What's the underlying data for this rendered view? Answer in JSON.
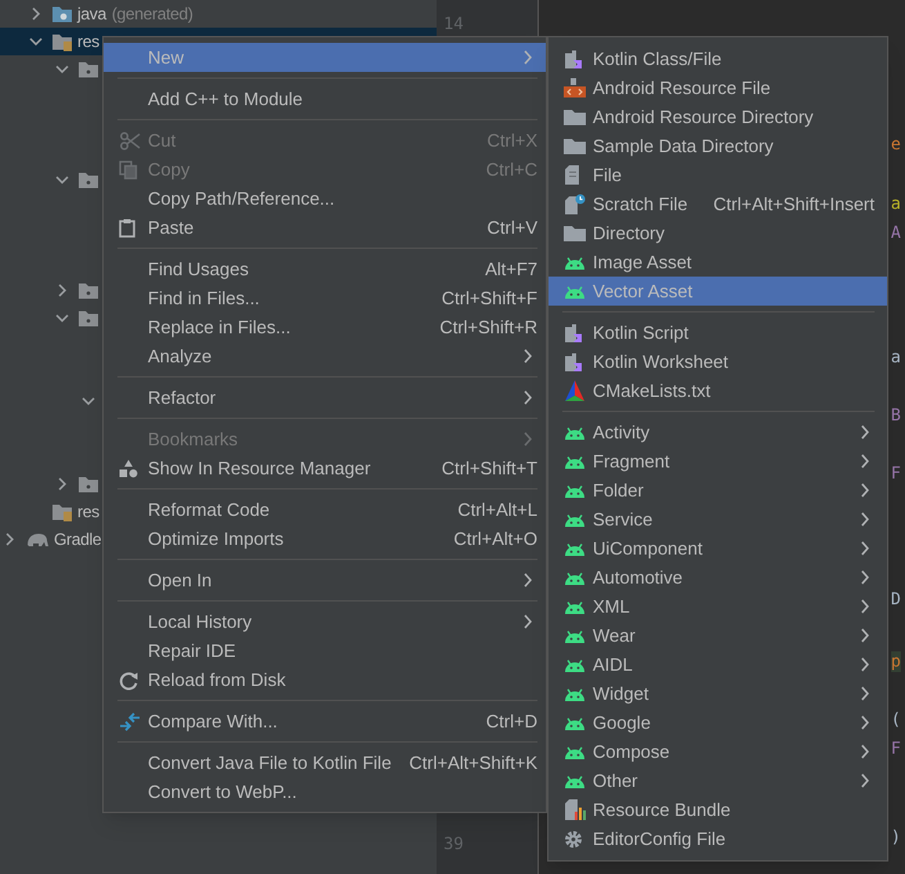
{
  "project_tree": [
    {
      "children": [
        {
          "label": "java",
          "note": "(generated)",
          "kind": "java",
          "expanded": false,
          "selected": false
        },
        {
          "label": "res",
          "kind": "res",
          "expanded": true,
          "selected": true,
          "children": [
            {
              "kind": "folder",
              "expanded": true,
              "selected": false
            },
            {
              "kind": "folder",
              "expanded": true,
              "selected": false
            },
            {
              "kind": "folder",
              "expanded": false,
              "selected": false
            },
            {
              "kind": "folder",
              "expanded": true,
              "selected": false,
              "children": [
                {
                  "expanded": true,
                  "selected": false
                }
              ]
            },
            {
              "kind": "folder",
              "expanded": false,
              "selected": false
            }
          ]
        },
        {
          "label": "res",
          "kind": "res",
          "selected": false
        }
      ]
    },
    {
      "label": "Gradle",
      "kind": "gradle",
      "expanded": false,
      "selected": false
    }
  ],
  "line_numbers": [
    "14",
    "39"
  ],
  "code_fragments": [
    {
      "text": "e",
      "color": "#cc7832"
    },
    {
      "text": "a",
      "color": "#bbb529"
    },
    {
      "text": "A",
      "color": "#9876aa"
    },
    {
      "text": "a",
      "color": "#a9b7c6"
    },
    {
      "text": "B",
      "color": "#9876aa"
    },
    {
      "text": "F",
      "color": "#9876aa"
    },
    {
      "text": "D",
      "color": "#a9b7c6"
    },
    {
      "text": "p",
      "color": "#cc7832"
    },
    {
      "text": "(",
      "color": "#a9b7c6"
    },
    {
      "text": "F",
      "color": "#9876aa"
    },
    {
      "text": ")",
      "color": "#a9b7c6"
    }
  ],
  "context_menu": {
    "items": [
      {
        "kind": "item",
        "label": "New",
        "has_submenu": true,
        "disabled": false,
        "selected": true
      },
      {
        "kind": "separator"
      },
      {
        "kind": "item",
        "label": "Add C++ to Module",
        "has_submenu": false,
        "disabled": false,
        "selected": false
      },
      {
        "kind": "separator"
      },
      {
        "kind": "item",
        "label": "Cut",
        "shortcut": "Ctrl+X",
        "has_submenu": false,
        "disabled": true,
        "selected": false
      },
      {
        "kind": "item",
        "label": "Copy",
        "shortcut": "Ctrl+C",
        "has_submenu": false,
        "disabled": true,
        "selected": false
      },
      {
        "kind": "item",
        "label": "Copy Path/Reference...",
        "has_submenu": false,
        "disabled": false,
        "selected": false
      },
      {
        "kind": "item",
        "label": "Paste",
        "shortcut": "Ctrl+V",
        "has_submenu": false,
        "disabled": false,
        "selected": false
      },
      {
        "kind": "separator"
      },
      {
        "kind": "item",
        "label": "Find Usages",
        "shortcut": "Alt+F7",
        "has_submenu": false,
        "disabled": false,
        "selected": false
      },
      {
        "kind": "item",
        "label": "Find in Files...",
        "shortcut": "Ctrl+Shift+F",
        "has_submenu": false,
        "disabled": false,
        "selected": false
      },
      {
        "kind": "item",
        "label": "Replace in Files...",
        "shortcut": "Ctrl+Shift+R",
        "has_submenu": false,
        "disabled": false,
        "selected": false
      },
      {
        "kind": "item",
        "label": "Analyze",
        "has_submenu": true,
        "disabled": false,
        "selected": false
      },
      {
        "kind": "separator"
      },
      {
        "kind": "item",
        "label": "Refactor",
        "has_submenu": true,
        "disabled": false,
        "selected": false
      },
      {
        "kind": "separator"
      },
      {
        "kind": "item",
        "label": "Bookmarks",
        "has_submenu": true,
        "disabled": true,
        "selected": false
      },
      {
        "kind": "item",
        "label": "Show In Resource Manager",
        "shortcut": "Ctrl+Shift+T",
        "has_submenu": false,
        "disabled": false,
        "selected": false
      },
      {
        "kind": "separator"
      },
      {
        "kind": "item",
        "label": "Reformat Code",
        "shortcut": "Ctrl+Alt+L",
        "has_submenu": false,
        "disabled": false,
        "selected": false
      },
      {
        "kind": "item",
        "label": "Optimize Imports",
        "shortcut": "Ctrl+Alt+O",
        "has_submenu": false,
        "disabled": false,
        "selected": false
      },
      {
        "kind": "separator"
      },
      {
        "kind": "item",
        "label": "Open In",
        "has_submenu": true,
        "disabled": false,
        "selected": false
      },
      {
        "kind": "separator"
      },
      {
        "kind": "item",
        "label": "Local History",
        "has_submenu": true,
        "disabled": false,
        "selected": false
      },
      {
        "kind": "item",
        "label": "Repair IDE",
        "has_submenu": false,
        "disabled": false,
        "selected": false
      },
      {
        "kind": "item",
        "label": "Reload from Disk",
        "has_submenu": false,
        "disabled": false,
        "selected": false
      },
      {
        "kind": "separator"
      },
      {
        "kind": "item",
        "label": "Compare With...",
        "shortcut": "Ctrl+D",
        "has_submenu": false,
        "disabled": false,
        "selected": false
      },
      {
        "kind": "separator"
      },
      {
        "kind": "item",
        "label": "Convert Java File to Kotlin File",
        "shortcut": "Ctrl+Alt+Shift+K",
        "has_submenu": false,
        "disabled": false,
        "selected": false
      },
      {
        "kind": "item",
        "label": "Convert to WebP...",
        "has_submenu": false,
        "disabled": false,
        "selected": false
      }
    ]
  },
  "new_submenu": {
    "items": [
      {
        "kind": "item",
        "label": "Kotlin Class/File",
        "has_submenu": false,
        "selected": false
      },
      {
        "kind": "item",
        "label": "Android Resource File",
        "has_submenu": false,
        "selected": false
      },
      {
        "kind": "item",
        "label": "Android Resource Directory",
        "has_submenu": false,
        "selected": false
      },
      {
        "kind": "item",
        "label": "Sample Data Directory",
        "has_submenu": false,
        "selected": false
      },
      {
        "kind": "item",
        "label": "File",
        "has_submenu": false,
        "selected": false
      },
      {
        "kind": "item",
        "label": "Scratch File",
        "shortcut": "Ctrl+Alt+Shift+Insert",
        "has_submenu": false,
        "selected": false
      },
      {
        "kind": "item",
        "label": "Directory",
        "has_submenu": false,
        "selected": false
      },
      {
        "kind": "item",
        "label": "Image Asset",
        "has_submenu": false,
        "selected": false
      },
      {
        "kind": "item",
        "label": "Vector Asset",
        "has_submenu": false,
        "selected": true
      },
      {
        "kind": "separator"
      },
      {
        "kind": "item",
        "label": "Kotlin Script",
        "has_submenu": false,
        "selected": false
      },
      {
        "kind": "item",
        "label": "Kotlin Worksheet",
        "has_submenu": false,
        "selected": false
      },
      {
        "kind": "item",
        "label": "CMakeLists.txt",
        "has_submenu": false,
        "selected": false
      },
      {
        "kind": "separator"
      },
      {
        "kind": "item",
        "label": "Activity",
        "has_submenu": true,
        "selected": false
      },
      {
        "kind": "item",
        "label": "Fragment",
        "has_submenu": true,
        "selected": false
      },
      {
        "kind": "item",
        "label": "Folder",
        "has_submenu": true,
        "selected": false
      },
      {
        "kind": "item",
        "label": "Service",
        "has_submenu": true,
        "selected": false
      },
      {
        "kind": "item",
        "label": "UiComponent",
        "has_submenu": true,
        "selected": false
      },
      {
        "kind": "item",
        "label": "Automotive",
        "has_submenu": true,
        "selected": false
      },
      {
        "kind": "item",
        "label": "XML",
        "has_submenu": true,
        "selected": false
      },
      {
        "kind": "item",
        "label": "Wear",
        "has_submenu": true,
        "selected": false
      },
      {
        "kind": "item",
        "label": "AIDL",
        "has_submenu": true,
        "selected": false
      },
      {
        "kind": "item",
        "label": "Widget",
        "has_submenu": true,
        "selected": false
      },
      {
        "kind": "item",
        "label": "Google",
        "has_submenu": true,
        "selected": false
      },
      {
        "kind": "item",
        "label": "Compose",
        "has_submenu": true,
        "selected": false
      },
      {
        "kind": "item",
        "label": "Other",
        "has_submenu": true,
        "selected": false
      },
      {
        "kind": "item",
        "label": "Resource Bundle",
        "has_submenu": false,
        "selected": false
      },
      {
        "kind": "item",
        "label": "EditorConfig File",
        "has_submenu": false,
        "selected": false
      }
    ]
  }
}
